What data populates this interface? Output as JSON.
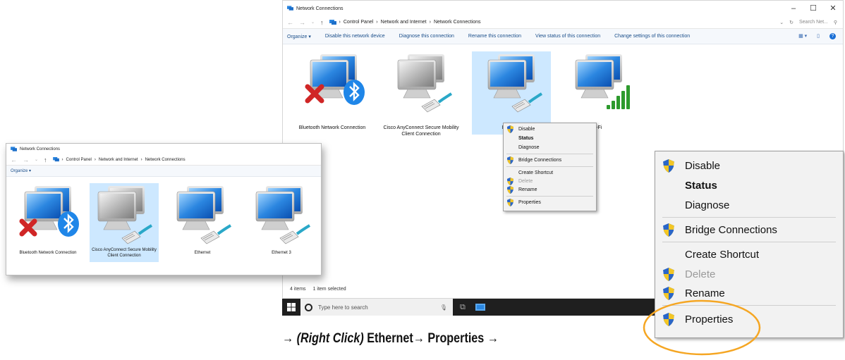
{
  "large_window": {
    "title": "Network Connections",
    "controls": [
      "–",
      "☐",
      "✕"
    ],
    "breadcrumb": [
      "Control Panel",
      "Network and Internet",
      "Network Connections"
    ],
    "search_placeholder": "Search Net...",
    "commands": [
      "Organize ▾",
      "Disable this network device",
      "Diagnose this connection",
      "Rename this connection",
      "View status of this connection",
      "Change settings of this connection"
    ],
    "items": [
      {
        "label": "Bluetooth Network Connection"
      },
      {
        "label": "Cisco AnyConnect Secure Mobility Client Connection"
      },
      {
        "label": "Ethernet"
      },
      {
        "label": "Wi-Fi"
      }
    ],
    "status": {
      "count": "4 items",
      "selected": "1 item selected"
    }
  },
  "small_context_menu": [
    "Disable",
    "Status",
    "Diagnose",
    "Bridge Connections",
    "Create Shortcut",
    "Delete",
    "Rename",
    "Properties"
  ],
  "small_window": {
    "title": "Network Connections",
    "breadcrumb": [
      "Control Panel",
      "Network and Internet",
      "Network Connections"
    ],
    "organize": "Organize ▾",
    "items": [
      {
        "label": "Bluetooth Network Connection"
      },
      {
        "label": "Cisco AnyConnect Secure Mobility Client Connection"
      },
      {
        "label": "Ethernet"
      },
      {
        "label": "Ethernet 3"
      }
    ]
  },
  "taskbar": {
    "search_text": "Type here to search"
  },
  "zoom_menu": {
    "items": [
      "Disable",
      "Status",
      "Diagnose",
      "Bridge Connections",
      "Create Shortcut",
      "Delete",
      "Rename",
      "Properties"
    ],
    "highlight_color": "#f5a623"
  },
  "caption": {
    "arrow": "→",
    "italic": "(Right Click)",
    "part1": " Ethernet",
    "part2": " Properties "
  }
}
